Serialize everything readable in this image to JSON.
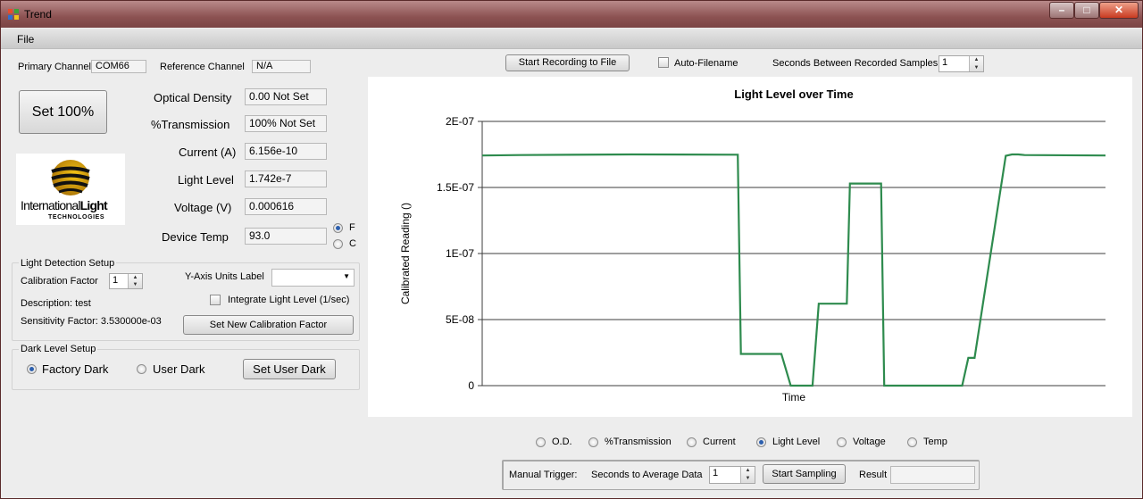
{
  "window": {
    "title": "Trend"
  },
  "menu": {
    "file": "File"
  },
  "channels": {
    "primary_label": "Primary Channel",
    "primary_value": "COM66",
    "reference_label": "Reference Channel",
    "reference_value": "N/A"
  },
  "set100_button": "Set 100%",
  "readings": [
    {
      "label": "Optical Density",
      "value": "0.00   Not Set"
    },
    {
      "label": "%Transmission",
      "value": "100% Not Set"
    },
    {
      "label": "Current (A)",
      "value": "6.156e-10"
    },
    {
      "label": "Light Level",
      "value": "1.742e-7"
    },
    {
      "label": "Voltage (V)",
      "value": "0.000616"
    },
    {
      "label": "Device Temp",
      "value": "93.0"
    }
  ],
  "temp_units": {
    "f": "F",
    "c": "C",
    "selected": "F"
  },
  "logo": {
    "line1a": "International",
    "line1b": "Light",
    "line2": "TECHNOLOGIES"
  },
  "light_detection": {
    "title": "Light Detection Setup",
    "cal_factor_label": "Calibration Factor",
    "cal_factor_value": "1",
    "description": "Description:  test",
    "sensitivity": "Sensitivity Factor:  3.530000e-03",
    "yaxis_units_label": "Y-Axis Units Label",
    "yaxis_units_value": "",
    "integrate_label": "Integrate Light Level (1/sec)",
    "set_cal_button": "Set New Calibration Factor"
  },
  "dark_level": {
    "title": "Dark Level Setup",
    "factory": "Factory Dark",
    "user": "User Dark",
    "selected": "Factory Dark",
    "set_user_button": "Set User Dark"
  },
  "recording": {
    "start_button": "Start Recording to File",
    "auto_filename": "Auto-Filename",
    "seconds_label": "Seconds Between Recorded Samples",
    "seconds_value": "1"
  },
  "chart_data": {
    "type": "line",
    "title": "Light Level over Time",
    "xlabel": "Time",
    "ylabel": "Calibrated Reading ()",
    "ylim": [
      0,
      2e-07
    ],
    "yticks": [
      0,
      5e-08,
      1e-07,
      1.5e-07,
      2e-07
    ],
    "ytick_labels": [
      "0",
      "5E-08",
      "1E-07",
      "1.5E-07",
      "2E-07"
    ],
    "grid": true,
    "series_color": "#2e8b4e",
    "series": [
      {
        "x": [
          0,
          0.06,
          0.24,
          0.41,
          0.415,
          0.48,
          0.495,
          0.53,
          0.54,
          0.585,
          0.59,
          0.64,
          0.645,
          0.67,
          0.68,
          0.76,
          0.77,
          0.78,
          0.79,
          0.84,
          0.85,
          0.86,
          0.87,
          1.0
        ],
        "y": [
          1.742e-07,
          1.745e-07,
          1.75e-07,
          1.748e-07,
          2.4e-08,
          2.4e-08,
          0,
          0,
          6.2e-08,
          6.2e-08,
          1.53e-07,
          1.53e-07,
          0,
          0,
          0,
          0,
          0,
          2.1e-08,
          2.1e-08,
          1.74e-07,
          1.75e-07,
          1.75e-07,
          1.745e-07,
          1.742e-07
        ]
      }
    ]
  },
  "plot_select": {
    "options": [
      "O.D.",
      "%Transmission",
      "Current",
      "Light Level",
      "Voltage",
      "Temp"
    ],
    "selected": "Light Level"
  },
  "manual": {
    "label": "Manual Trigger:",
    "seconds_label": "Seconds to Average Data",
    "seconds_value": "1",
    "start_button": "Start Sampling",
    "result_label": "Result",
    "result_value": ""
  }
}
